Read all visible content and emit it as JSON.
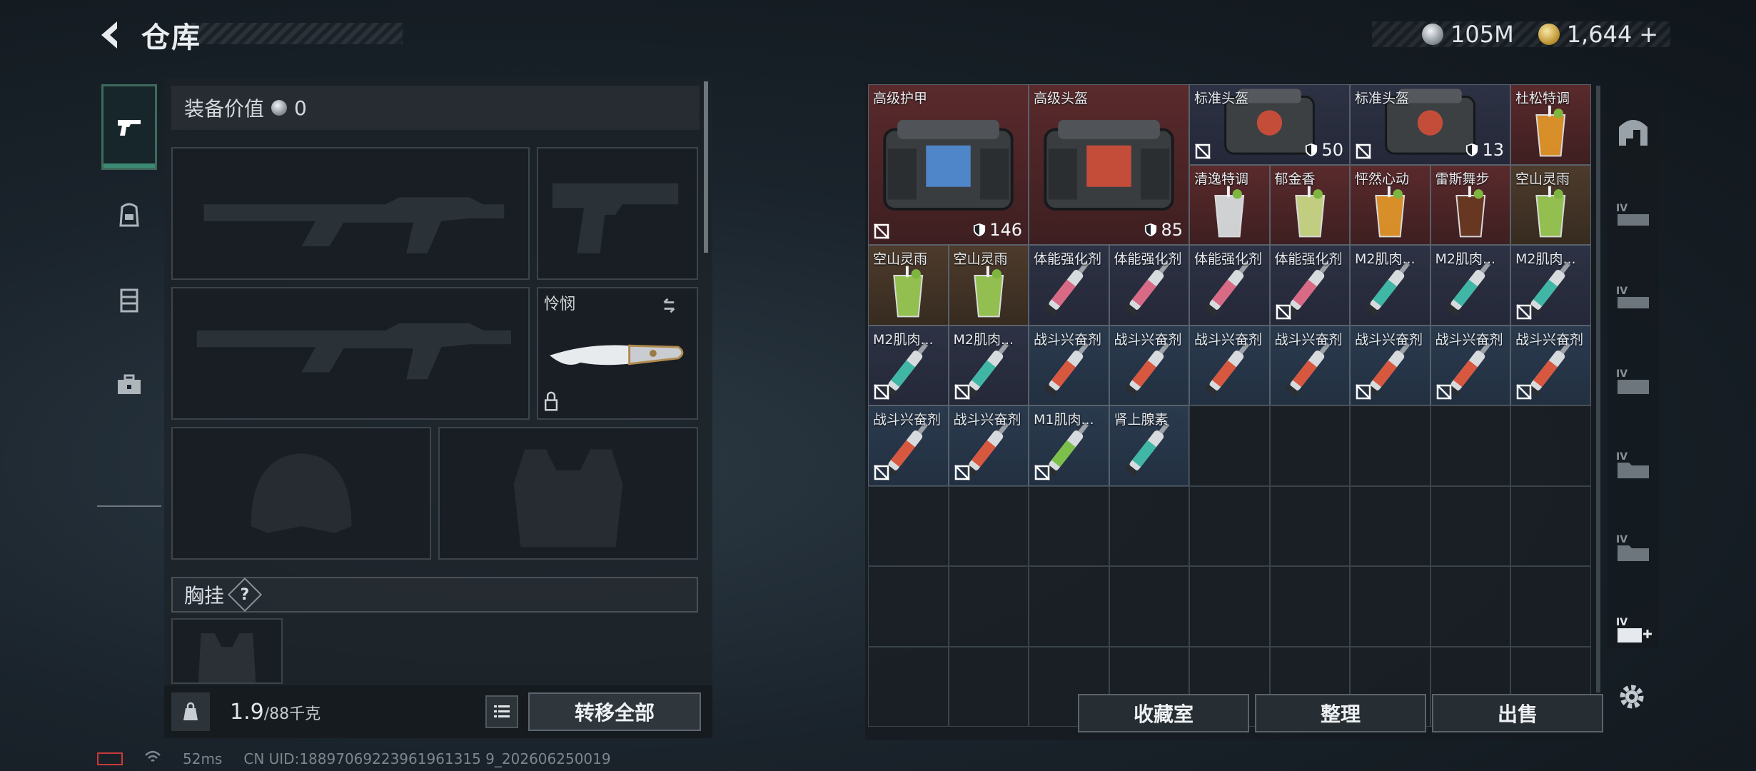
{
  "header": {
    "title": "仓库"
  },
  "currency": {
    "silver": "105M",
    "gold": "1,644",
    "gold_plus": "+"
  },
  "left_tabs": [
    "weapon-icon",
    "backpack-icon",
    "rig-icon",
    "case-icon"
  ],
  "equipment": {
    "value_label": "装备价值",
    "value": "0",
    "knife_label": "怜悯",
    "chest_label": "胸挂",
    "chest_help": "?"
  },
  "bottom_left": {
    "weight": "1.9",
    "weight_cap": "/88千克",
    "transfer_all": "转移全部"
  },
  "inventory": {
    "items": [
      {
        "name": "高级护甲",
        "col": 0,
        "row": 0,
        "w": 2,
        "h": 2,
        "type": "armor",
        "bg": "red",
        "durability": "146",
        "nocarry": true
      },
      {
        "name": "高级头盔",
        "col": 2,
        "row": 0,
        "w": 2,
        "h": 2,
        "type": "armor2",
        "bg": "red",
        "durability": "85",
        "nocarry": false
      },
      {
        "name": "标准头盔",
        "col": 4,
        "row": 0,
        "w": 2,
        "h": 1,
        "type": "helmet",
        "bg": "navy",
        "durability": "50",
        "nocarry": true
      },
      {
        "name": "标准头盔",
        "col": 6,
        "row": 0,
        "w": 2,
        "h": 1,
        "type": "helmet",
        "bg": "navy",
        "durability": "13",
        "nocarry": true
      },
      {
        "name": "杜松特调",
        "col": 8,
        "row": 0,
        "w": 1,
        "h": 1,
        "type": "drink-orange",
        "bg": "red"
      },
      {
        "name": "清逸特调",
        "col": 4,
        "row": 1,
        "w": 1,
        "h": 1,
        "type": "drink-clear",
        "bg": "red"
      },
      {
        "name": "郁金香",
        "col": 5,
        "row": 1,
        "w": 1,
        "h": 1,
        "type": "drink-lime",
        "bg": "red"
      },
      {
        "name": "怦然心动",
        "col": 6,
        "row": 1,
        "w": 1,
        "h": 1,
        "type": "drink-orange",
        "bg": "red"
      },
      {
        "name": "雷斯舞步",
        "col": 7,
        "row": 1,
        "w": 1,
        "h": 1,
        "type": "drink-dark",
        "bg": "red"
      },
      {
        "name": "空山灵雨",
        "col": 8,
        "row": 1,
        "w": 1,
        "h": 1,
        "type": "drink-green",
        "bg": "brown"
      },
      {
        "name": "空山灵雨",
        "col": 0,
        "row": 2,
        "w": 1,
        "h": 1,
        "type": "drink-green",
        "bg": "brown"
      },
      {
        "name": "空山灵雨",
        "col": 1,
        "row": 2,
        "w": 1,
        "h": 1,
        "type": "drink-green",
        "bg": "brown"
      },
      {
        "name": "体能强化剂",
        "col": 2,
        "row": 2,
        "w": 1,
        "h": 1,
        "type": "syringe-pink",
        "bg": "navy"
      },
      {
        "name": "体能强化剂",
        "col": 3,
        "row": 2,
        "w": 1,
        "h": 1,
        "type": "syringe-pink",
        "bg": "navy"
      },
      {
        "name": "体能强化剂",
        "col": 4,
        "row": 2,
        "w": 1,
        "h": 1,
        "type": "syringe-pink",
        "bg": "navy"
      },
      {
        "name": "体能强化剂",
        "col": 5,
        "row": 2,
        "w": 1,
        "h": 1,
        "type": "syringe-pink",
        "bg": "navy",
        "nocarry": true
      },
      {
        "name": "M2肌肉...",
        "col": 6,
        "row": 2,
        "w": 1,
        "h": 1,
        "type": "syringe-teal",
        "bg": "navy"
      },
      {
        "name": "M2肌肉...",
        "col": 7,
        "row": 2,
        "w": 1,
        "h": 1,
        "type": "syringe-teal",
        "bg": "navy"
      },
      {
        "name": "M2肌肉...",
        "col": 8,
        "row": 2,
        "w": 1,
        "h": 1,
        "type": "syringe-teal",
        "bg": "navy",
        "nocarry": true
      },
      {
        "name": "M2肌肉...",
        "col": 0,
        "row": 3,
        "w": 1,
        "h": 1,
        "type": "syringe-teal",
        "bg": "navy",
        "nocarry": true
      },
      {
        "name": "M2肌肉...",
        "col": 1,
        "row": 3,
        "w": 1,
        "h": 1,
        "type": "syringe-teal",
        "bg": "navy",
        "nocarry": true
      },
      {
        "name": "战斗兴奋剂",
        "col": 2,
        "row": 3,
        "w": 1,
        "h": 1,
        "type": "syringe-red",
        "bg": "blue"
      },
      {
        "name": "战斗兴奋剂",
        "col": 3,
        "row": 3,
        "w": 1,
        "h": 1,
        "type": "syringe-red",
        "bg": "blue"
      },
      {
        "name": "战斗兴奋剂",
        "col": 4,
        "row": 3,
        "w": 1,
        "h": 1,
        "type": "syringe-red",
        "bg": "blue"
      },
      {
        "name": "战斗兴奋剂",
        "col": 5,
        "row": 3,
        "w": 1,
        "h": 1,
        "type": "syringe-red",
        "bg": "blue"
      },
      {
        "name": "战斗兴奋剂",
        "col": 6,
        "row": 3,
        "w": 1,
        "h": 1,
        "type": "syringe-red",
        "bg": "blue",
        "nocarry": true
      },
      {
        "name": "战斗兴奋剂",
        "col": 7,
        "row": 3,
        "w": 1,
        "h": 1,
        "type": "syringe-red",
        "bg": "blue",
        "nocarry": true
      },
      {
        "name": "战斗兴奋剂",
        "col": 8,
        "row": 3,
        "w": 1,
        "h": 1,
        "type": "syringe-red",
        "bg": "blue",
        "nocarry": true
      },
      {
        "name": "战斗兴奋剂",
        "col": 0,
        "row": 4,
        "w": 1,
        "h": 1,
        "type": "syringe-red",
        "bg": "blue",
        "nocarry": true
      },
      {
        "name": "战斗兴奋剂",
        "col": 1,
        "row": 4,
        "w": 1,
        "h": 1,
        "type": "syringe-red",
        "bg": "blue",
        "nocarry": true
      },
      {
        "name": "M1肌肉...",
        "col": 2,
        "row": 4,
        "w": 1,
        "h": 1,
        "type": "syringe-green",
        "bg": "blue",
        "nocarry": true
      },
      {
        "name": "肾上腺素",
        "col": 3,
        "row": 4,
        "w": 1,
        "h": 1,
        "type": "syringe-teal",
        "bg": "blue"
      }
    ]
  },
  "right_tabs": [
    "safe-icon",
    "container-iv-1-icon",
    "container-iv-2-icon",
    "container-iv-3-icon",
    "container-iv-4-icon",
    "container-iv-5-icon",
    "container-iv-add-icon"
  ],
  "bottom_right": {
    "collection": "收藏室",
    "sort": "整理",
    "sell": "出售"
  },
  "status": {
    "ping": "52ms",
    "uid": "CN UID:18897069223961961315 9_202606250019"
  }
}
